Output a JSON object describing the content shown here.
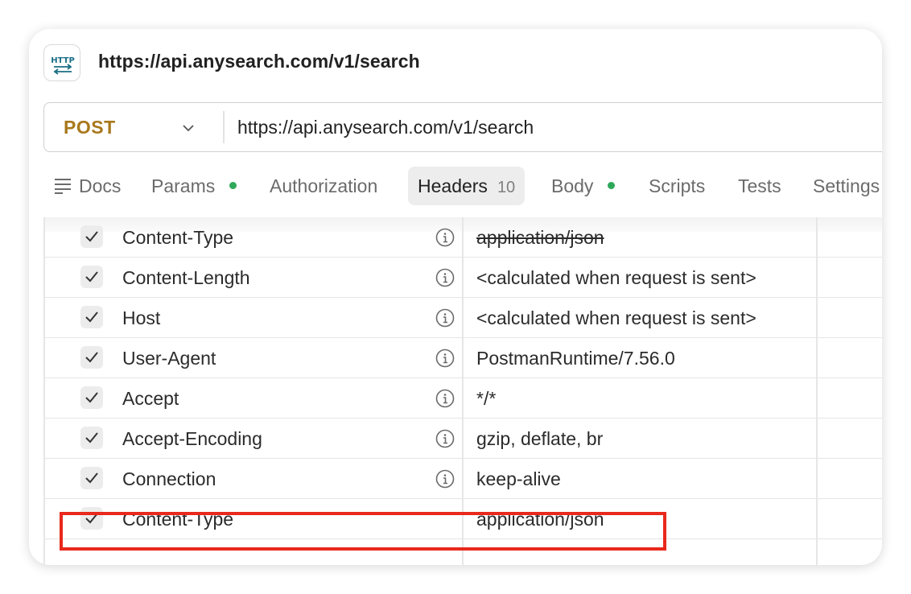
{
  "request": {
    "title": "https://api.anysearch.com/v1/search",
    "icon": "http-icon",
    "icon_text": "HTTP",
    "method": "POST",
    "url": "https://api.anysearch.com/v1/search"
  },
  "tabs": [
    {
      "label": "Docs",
      "icon": "docs-icon"
    },
    {
      "label": "Params",
      "dot": true
    },
    {
      "label": "Authorization"
    },
    {
      "label": "Headers",
      "count": "10",
      "active": true
    },
    {
      "label": "Body",
      "dot": true
    },
    {
      "label": "Scripts"
    },
    {
      "label": "Tests"
    },
    {
      "label": "Settings"
    }
  ],
  "headers": [
    {
      "key": "Content-Type",
      "value": "application/json",
      "info": true,
      "disabled_value": true,
      "checked": true
    },
    {
      "key": "Content-Length",
      "value": "<calculated when request is sent>",
      "info": true,
      "checked": true
    },
    {
      "key": "Host",
      "value": "<calculated when request is sent>",
      "info": true,
      "checked": true
    },
    {
      "key": "User-Agent",
      "value": "PostmanRuntime/7.56.0",
      "info": true,
      "checked": true
    },
    {
      "key": "Accept",
      "value": "*/*",
      "info": true,
      "checked": true
    },
    {
      "key": "Accept-Encoding",
      "value": "gzip, deflate, br",
      "info": true,
      "checked": true
    },
    {
      "key": "Connection",
      "value": "keep-alive",
      "info": true,
      "checked": true
    },
    {
      "key": "Content-Type",
      "value": "application/json",
      "info": false,
      "checked": true,
      "highlighted": true
    }
  ],
  "colors": {
    "method": "#a8781c",
    "status_dot": "#2fa85a",
    "highlight": "#e8291c"
  }
}
